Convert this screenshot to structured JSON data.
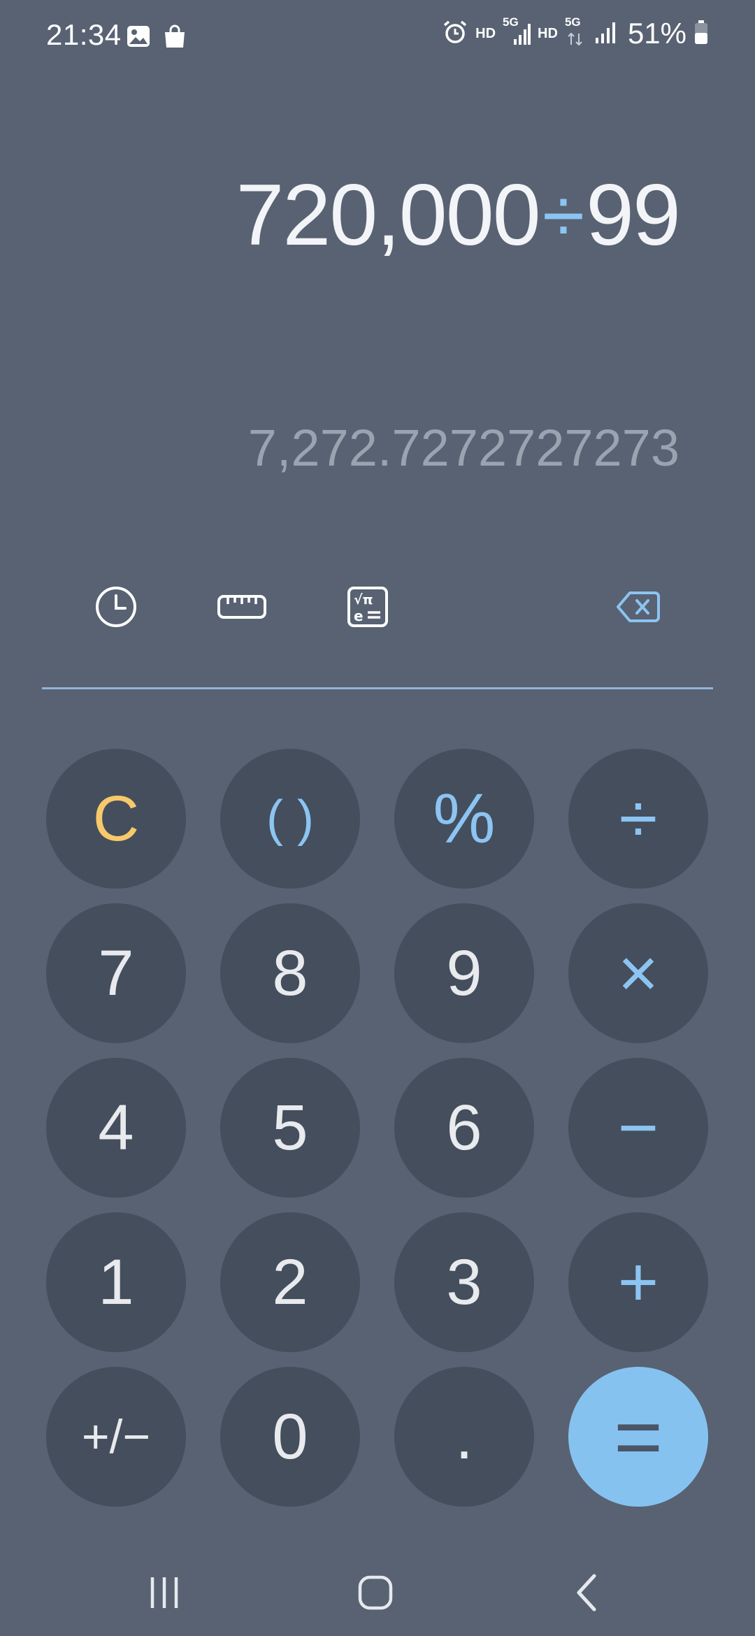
{
  "status_bar": {
    "time": "21:34",
    "net1": "HD",
    "net2": "HD",
    "sig1": "5G",
    "sig2": "5G",
    "battery": "51%"
  },
  "display": {
    "operand1": "720,000",
    "operator": "÷",
    "operand2": "99",
    "result": "7,272.7272727273"
  },
  "toolbar": {
    "history_icon": "clock-icon",
    "unit_converter_icon": "ruler-icon",
    "scientific_icon": "scientific-calculator-icon",
    "backspace_icon": "backspace-icon"
  },
  "keys": {
    "clear": "C",
    "parentheses": "( )",
    "percent": "%",
    "divide": "÷",
    "seven": "7",
    "eight": "8",
    "nine": "9",
    "multiply": "×",
    "four": "4",
    "five": "5",
    "six": "6",
    "minus": "−",
    "one": "1",
    "two": "2",
    "three": "3",
    "plus": "+",
    "plus_minus": "+/−",
    "zero": "0",
    "decimal": ".",
    "equals": "="
  },
  "colors": {
    "background": "#586272",
    "key": "#444e5c",
    "accent_blue": "#8cc4f2",
    "clear_yellow": "#f7c96a",
    "equals_bg": "#86c2f0"
  }
}
